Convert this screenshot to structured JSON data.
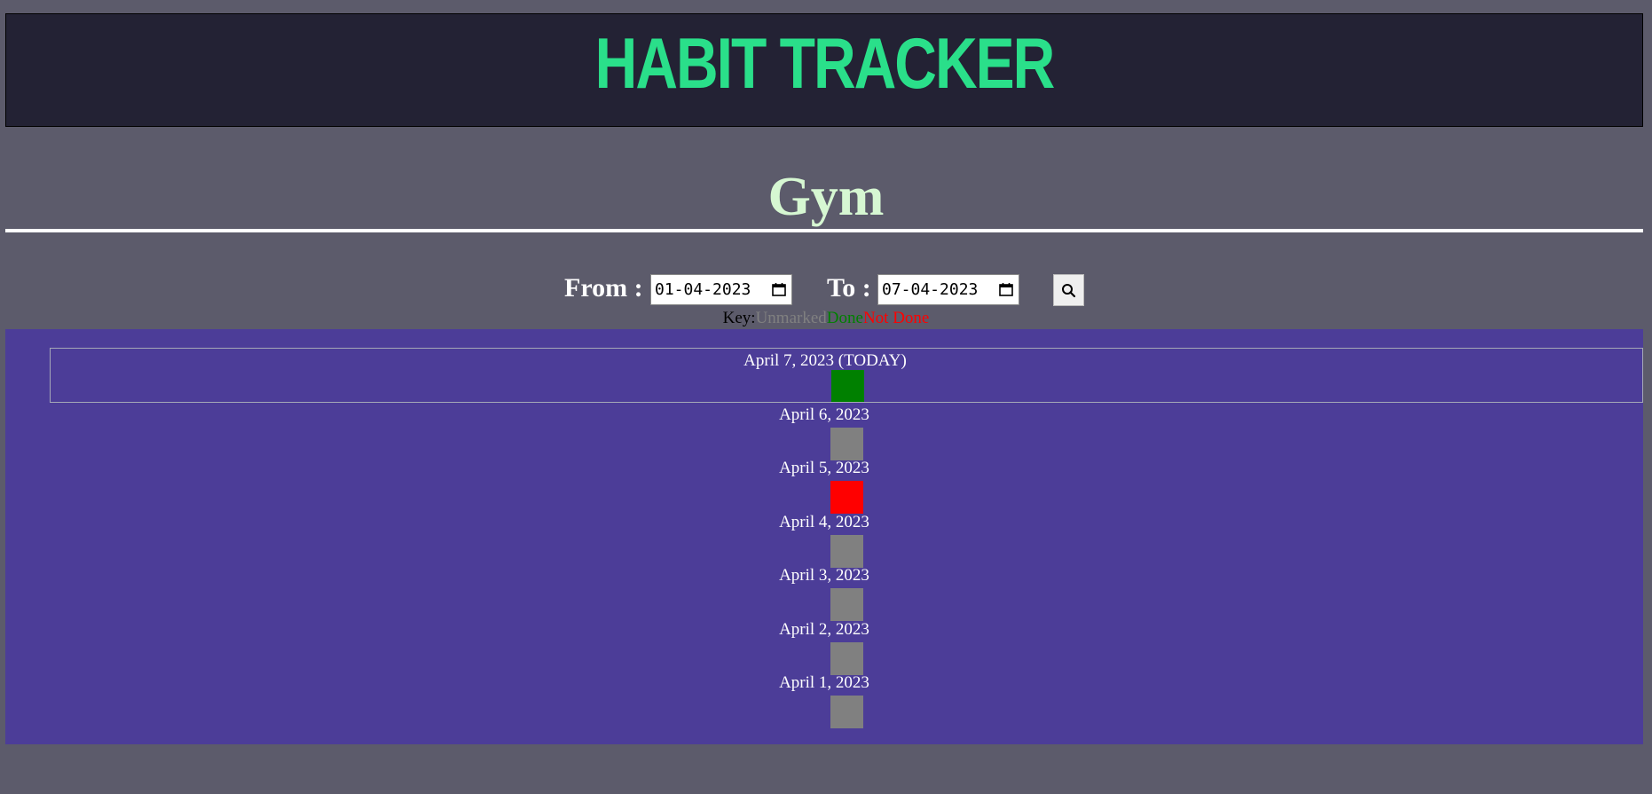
{
  "header": {
    "title": "HABIT TRACKER",
    "title_color": "#2adf8a"
  },
  "habit": {
    "name": "Gym"
  },
  "filter": {
    "from_label": "From :",
    "from_value": "01-04-2023",
    "to_label": "To :",
    "to_value": "07-04-2023",
    "search_icon": "search-icon"
  },
  "key": {
    "label": "Key:",
    "unmarked": "Unmarked",
    "done": "Done",
    "not_done": "Not Done"
  },
  "status_colors": {
    "unmarked": "#808080",
    "done": "#008000",
    "not_done": "#ff0000"
  },
  "days": [
    {
      "label": "April 7, 2023 (TODAY)",
      "status": "done",
      "today": true
    },
    {
      "label": "April 6, 2023",
      "status": "unmarked"
    },
    {
      "label": "April 5, 2023",
      "status": "not_done"
    },
    {
      "label": "April 4, 2023",
      "status": "unmarked"
    },
    {
      "label": "April 3, 2023",
      "status": "unmarked"
    },
    {
      "label": "April 2, 2023",
      "status": "unmarked"
    },
    {
      "label": "April 1, 2023",
      "status": "unmarked"
    }
  ]
}
